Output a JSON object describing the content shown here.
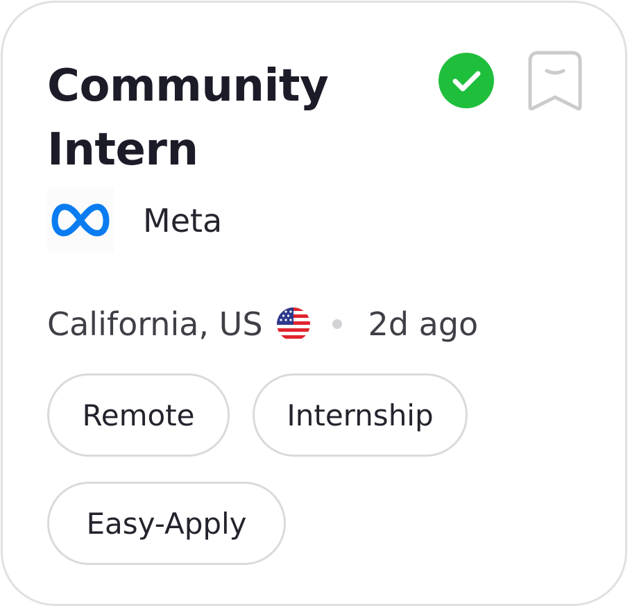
{
  "job": {
    "title": "Community Intern",
    "company": "Meta",
    "company_logo_icon": "meta-infinity-logo",
    "location": "California, US",
    "location_flag_icon": "us-flag-icon",
    "posted": "2d ago",
    "verified_icon": "check-circle-icon",
    "bookmark_icon": "bookmark-icon"
  },
  "tags": [
    "Remote",
    "Internship",
    "Easy-Apply"
  ],
  "colors": {
    "verified": "#1fbf3c",
    "meta_blue": "#0a7cf0",
    "border": "#e0e0e0",
    "title_text": "#1c1c28"
  }
}
